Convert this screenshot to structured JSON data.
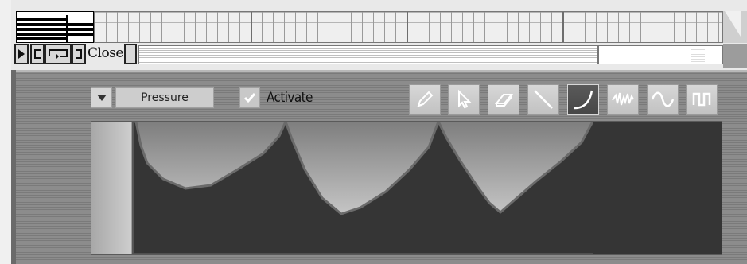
{
  "transport": {
    "close_label": "Close"
  },
  "automation": {
    "parameter": "Pressure",
    "activate_label": "Activate",
    "activate_checked": true
  },
  "tools": [
    {
      "name": "pencil-tool",
      "icon": "pencil-icon",
      "active": false
    },
    {
      "name": "select-tool",
      "icon": "arrow-pointer-icon",
      "active": false
    },
    {
      "name": "eraser-tool",
      "icon": "eraser-icon",
      "active": false
    },
    {
      "name": "line-tool",
      "icon": "line-icon",
      "active": false
    },
    {
      "name": "curve-tool",
      "icon": "curve-icon",
      "active": true
    },
    {
      "name": "random-tool",
      "icon": "random-wave-icon",
      "active": false
    },
    {
      "name": "sine-tool",
      "icon": "sine-wave-icon",
      "active": false
    },
    {
      "name": "square-tool",
      "icon": "square-wave-icon",
      "active": false
    }
  ],
  "colors": {
    "curve_fill": "#353535",
    "curve_stroke": "#6a6a6a",
    "background_gradient_top": "#7e7e7e",
    "background_gradient_bottom": "#e4e4e4"
  }
}
